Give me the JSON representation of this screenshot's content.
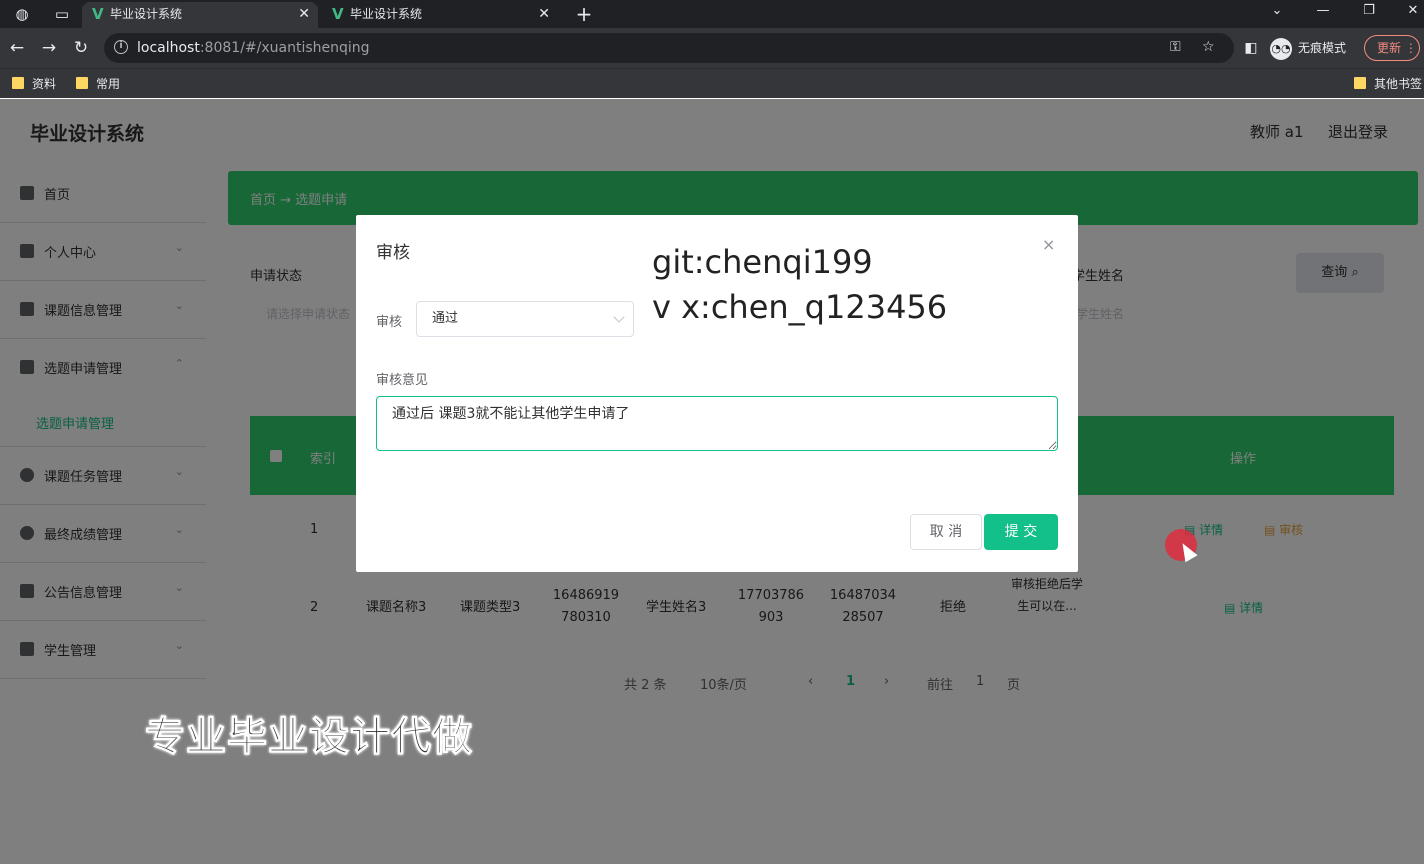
{
  "browser": {
    "tabs": [
      {
        "title": "毕业设计系统"
      },
      {
        "title": "毕业设计系统"
      }
    ],
    "url_host": "localhost",
    "url_rest": ":8081/#/xuantishenqing",
    "incognito_label": "无痕模式",
    "update_label": "更新",
    "bookmarks": [
      "资料",
      "常用"
    ],
    "other_bookmarks": "其他书签"
  },
  "app": {
    "brand": "毕业设计系统",
    "user": "教师 a1",
    "logout": "退出登录",
    "sidebar": [
      {
        "label": "首页"
      },
      {
        "label": "个人中心"
      },
      {
        "label": "课题信息管理"
      },
      {
        "label": "选题申请管理"
      },
      {
        "label": "选题申请管理",
        "sub": true
      },
      {
        "label": "课题任务管理"
      },
      {
        "label": "最终成绩管理"
      },
      {
        "label": "公告信息管理"
      },
      {
        "label": "学生管理"
      }
    ],
    "breadcrumb": "首页 → 选题申请",
    "filter": {
      "label": "申请状态",
      "placeholder": "请选择申请状态",
      "label2": "学生姓名",
      "placeholder2": "学生姓名",
      "query": "查询"
    },
    "table": {
      "headers": [
        "索引",
        "操作"
      ],
      "rows": [
        {
          "index": "1",
          "links": [
            "详情",
            "审核"
          ]
        },
        {
          "index": "2",
          "title": "课题名称3",
          "type": "课题类型3",
          "id": "16486919780310",
          "name": "学生姓名3",
          "phone": "17703786903",
          "num": "1648703428507",
          "status": "拒绝",
          "note": "审核拒绝后学生可以在...",
          "links": [
            "详情"
          ]
        }
      ]
    },
    "pager": {
      "total": "共 2 条",
      "size": "10条/页",
      "page": "1",
      "goto": "前往",
      "goto_val": "1",
      "goto_unit": "页"
    }
  },
  "dialog": {
    "title": "审核",
    "close": "×",
    "audit_label": "审核",
    "audit_value": "通过",
    "opinion_label": "审核意见",
    "opinion_value": "通过后 课题3就不能让其他学生申请了",
    "cancel": "取 消",
    "submit": "提 交"
  },
  "watermarks": {
    "git": "git:chenqi199",
    "vx": "v x:chen_q123456",
    "subtitle": "专业毕业设计代做"
  },
  "colors": {
    "accent": "#13c08a",
    "header_green": "#2fcf6f"
  }
}
